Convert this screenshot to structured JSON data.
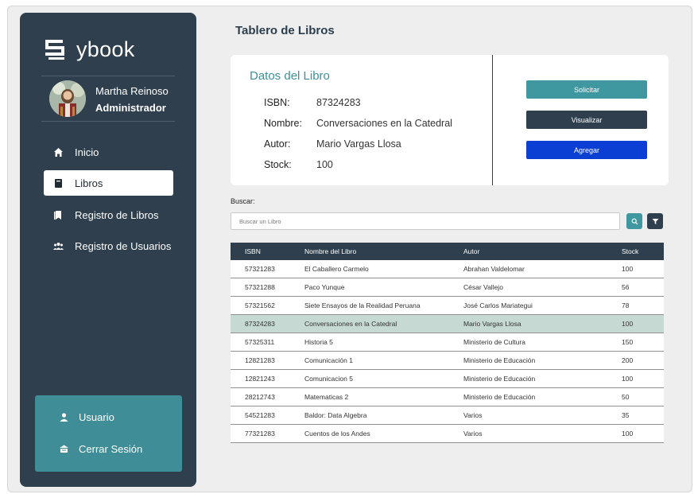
{
  "brand": {
    "name": "ybook"
  },
  "user": {
    "name": "Martha Reinoso",
    "role": "Administrador"
  },
  "nav": {
    "items": [
      {
        "label": "Inicio",
        "icon": "home-icon"
      },
      {
        "label": "Libros",
        "icon": "book-icon"
      },
      {
        "label": "Registro de Libros",
        "icon": "book-register-icon"
      },
      {
        "label": "Registro de Usuarios",
        "icon": "users-icon"
      }
    ],
    "active": "Libros"
  },
  "bottom": {
    "usuario": "Usuario",
    "logout": "Cerrar Sesión"
  },
  "page": {
    "title": "Tablero de Libros"
  },
  "book_card": {
    "title": "Datos del Libro",
    "isbn_label": "ISBN:",
    "isbn": "87324283",
    "name_label": "Nombre:",
    "name": "Conversaciones en la Catedral",
    "author_label": "Autor:",
    "author": "Mario Vargas Llosa",
    "stock_label": "Stock:",
    "stock": "100"
  },
  "actions": {
    "solicitar": "Solicitar",
    "visualizar": "Visualizar",
    "agregar": "Agregar"
  },
  "search": {
    "label": "Buscar:",
    "placeholder": "Buscar un Libro",
    "value": ""
  },
  "table": {
    "headers": [
      "ISBN",
      "Nombre del Libro",
      "Autor",
      "Stock"
    ],
    "rows": [
      [
        "57321283",
        "El Caballero Carmelo",
        "Abrahan Valdelomar",
        "100"
      ],
      [
        "57321288",
        "Paco Yunque",
        "César Vallejo",
        "56"
      ],
      [
        "57321562",
        "Siete Ensayos de la Realidad Peruana",
        "José Carlos Mariategui",
        "78"
      ],
      [
        "87324283",
        "Conversaciones en la Catedral",
        "Mario Vargas Llosa",
        "100"
      ],
      [
        "57325311",
        "Historia 5",
        "Ministerio de Cultura",
        "150"
      ],
      [
        "12821283",
        "Comunicación 1",
        "Ministerio de Educación",
        "200"
      ],
      [
        "12821243",
        "Comunicacion 5",
        "Ministerio de Educación",
        "100"
      ],
      [
        "28212743",
        "Matematicas 2",
        "Ministerio de Educación",
        "50"
      ],
      [
        "54521283",
        "Baldor: Data Algebra",
        "Varios",
        "35"
      ],
      [
        "77321283",
        "Cuentos de los Andes",
        "Varios",
        "100"
      ]
    ],
    "selected_row": 3
  },
  "colors": {
    "sidebar": "#2f3f4d",
    "accent": "#3f97a0",
    "primary_blue": "#0b3fd4",
    "highlight_row": "#c6d9d2"
  }
}
